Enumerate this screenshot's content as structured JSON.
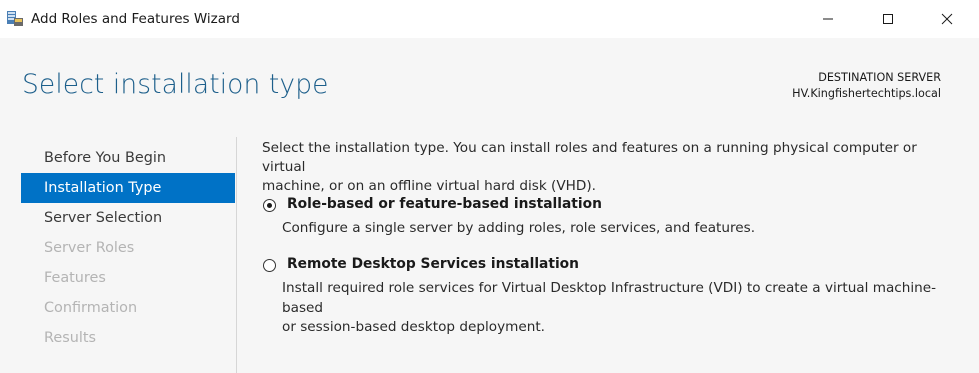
{
  "window": {
    "title": "Add Roles and Features Wizard",
    "controls": {
      "minimize": "minimize-icon",
      "maximize": "maximize-icon",
      "close": "close-icon"
    }
  },
  "header": {
    "page_title": "Select installation type",
    "destination_label": "DESTINATION SERVER",
    "destination_server": "HV.Kingfishertechtips.local"
  },
  "nav": {
    "items": [
      {
        "label": "Before You Begin",
        "state": "normal"
      },
      {
        "label": "Installation Type",
        "state": "active"
      },
      {
        "label": "Server Selection",
        "state": "normal"
      },
      {
        "label": "Server Roles",
        "state": "disabled"
      },
      {
        "label": "Features",
        "state": "disabled"
      },
      {
        "label": "Confirmation",
        "state": "disabled"
      },
      {
        "label": "Results",
        "state": "disabled"
      }
    ]
  },
  "content": {
    "intro_line1": "Select the installation type. You can install roles and features on a running physical computer or virtual",
    "intro_line2": "machine, or on an offline virtual hard disk (VHD).",
    "options": [
      {
        "label": "Role-based or feature-based installation",
        "selected": true,
        "desc_line1": "Configure a single server by adding roles, role services, and features.",
        "desc_line2": ""
      },
      {
        "label": "Remote Desktop Services installation",
        "selected": false,
        "desc_line1": "Install required role services for Virtual Desktop Infrastructure (VDI) to create a virtual machine-based",
        "desc_line2": "or session-based desktop deployment."
      }
    ]
  },
  "colors": {
    "accent": "#0072c6",
    "title_blue": "#1d5f8b",
    "disabled_text": "#b4b4b4",
    "panel_bg": "#f6f6f6"
  }
}
